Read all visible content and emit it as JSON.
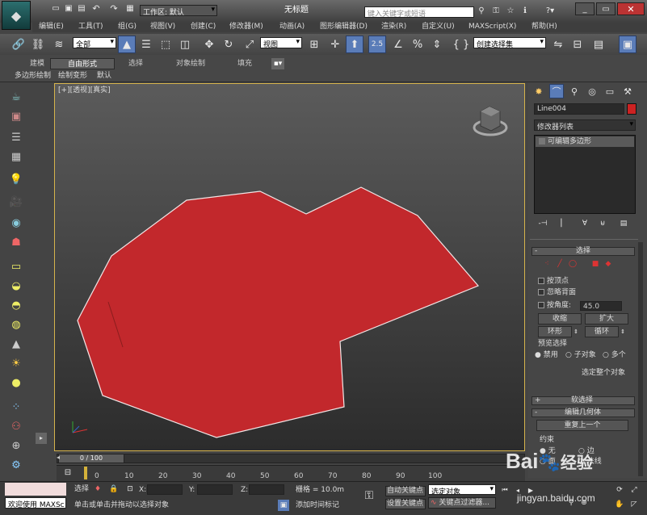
{
  "window": {
    "title": "无标题",
    "workspace": "工作区: 默认",
    "search_placeholder": "键入关键字或短语"
  },
  "menu": [
    "编辑(E)",
    "工具(T)",
    "组(G)",
    "视图(V)",
    "创建(C)",
    "修改器(M)",
    "动画(A)",
    "图形编辑器(D)",
    "渲染(R)",
    "自定义(U)",
    "MAXScript(X)",
    "帮助(H)"
  ],
  "toolbar": {
    "selection_filter": "全部",
    "ref_coord": "视图",
    "named_set": "创建选择集",
    "snap_label": "2.5"
  },
  "ribbon": {
    "tabs": [
      "建模",
      "自由形式",
      "选择",
      "对象绘制",
      "填充"
    ],
    "active": 1,
    "sub": [
      "多边形绘制",
      "绘制变形",
      "默认"
    ]
  },
  "viewport": {
    "label": "[+][透视][真实]"
  },
  "panel": {
    "object_name": "Line004",
    "modifier_list": "修改器列表",
    "stack_item": "可编辑多边形",
    "obj_color": "#cc2222"
  },
  "select_rollout": {
    "title": "选择",
    "by_vertex": "按顶点",
    "ignore_back": "忽略背面",
    "by_angle": "按角度:",
    "angle_value": "45.0",
    "shrink": "收缩",
    "grow": "扩大",
    "ring": "环形",
    "loop": "循环",
    "preview_label": "预览选择",
    "preview_opts": [
      "禁用",
      "子对象",
      "多个"
    ],
    "whole_obj": "选定整个对象"
  },
  "soft_rollout": {
    "title": "软选择"
  },
  "geo_rollout": {
    "title": "编辑几何体",
    "repeat": "重复上一个",
    "constraints": "约束",
    "opt_none": "无",
    "opt_edge": "边",
    "opt_face": "面",
    "opt_normal": "法线"
  },
  "timeline": {
    "frame": "0 / 100",
    "ticks": [
      "0",
      "10",
      "20",
      "30",
      "40",
      "50",
      "60",
      "70",
      "80",
      "90",
      "100"
    ]
  },
  "status": {
    "welcome": "欢迎使用 MAXSc",
    "select_label": "选择",
    "x_label": "X:",
    "y_label": "Y:",
    "z_label": "Z:",
    "grid": "栅格 = 10.0m",
    "prompt": "单击或单击并拖动以选择对象",
    "add_time": "添加时间标记",
    "auto_key": "自动关键点",
    "set_key": "设置关键点",
    "selected_obj": "选定对象",
    "key_filters": "关键点过滤器..."
  },
  "watermark": {
    "brand": "Bai",
    "brand2": "经验",
    "url": "jingyan.baidu.com"
  },
  "colors": {
    "shape": "#c2282c",
    "viewport_top": "#5b5b5b",
    "viewport_bottom": "#2c2c2c"
  }
}
